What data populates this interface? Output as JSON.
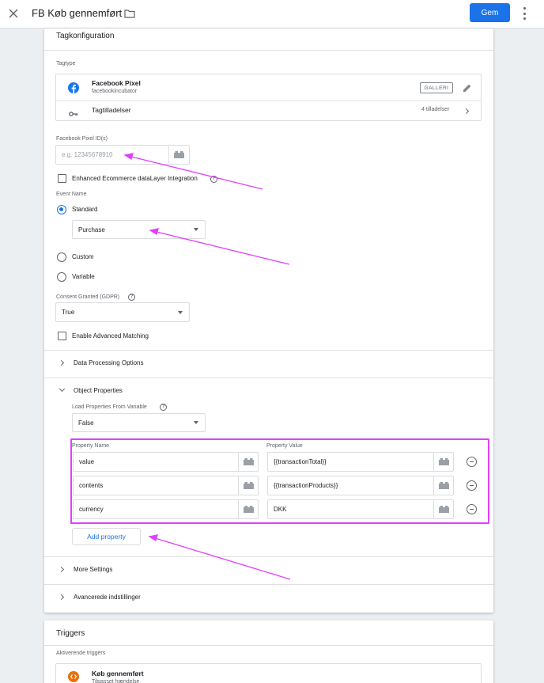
{
  "header": {
    "title": "FB Køb gennemført",
    "save_label": "Gem"
  },
  "tag_config": {
    "title": "Tagkonfiguration",
    "tag_type_label": "Tagtype",
    "tag_name": "Facebook Pixel",
    "tag_vendor": "facebookincubator",
    "gallery_label": "GALLERI",
    "permissions_label": "Tagtilladelser",
    "permissions_count": "4 tilladelser",
    "pixel_id_label": "Facebook Pixel ID(s)",
    "pixel_id_placeholder": "e.g. 12345678910",
    "enhanced_ecommerce_label": "Enhanced Ecommerce dataLayer Integration",
    "event_name_label": "Event Name",
    "event_options": {
      "standard": "Standard",
      "custom": "Custom",
      "variable": "Variable"
    },
    "standard_event_value": "Purchase",
    "consent_label": "Consent Granted (GDPR)",
    "consent_value": "True",
    "advanced_matching_label": "Enable Advanced Matching",
    "data_processing_label": "Data Processing Options",
    "object_properties_label": "Object Properties",
    "load_from_variable_label": "Load Properties From Variable",
    "load_from_variable_value": "False",
    "property_name_header": "Property Name",
    "property_value_header": "Property Value",
    "properties": [
      {
        "name": "value",
        "value": "{{transactionTotal}}"
      },
      {
        "name": "contents",
        "value": "{{transactionProducts}}"
      },
      {
        "name": "currency",
        "value": "DKK"
      }
    ],
    "add_property_label": "Add property",
    "more_settings_label": "More Settings",
    "advanced_settings_label": "Avancerede indstillinger"
  },
  "triggers": {
    "title": "Triggers",
    "firing_label": "Aktiverende triggers",
    "trigger_name": "Køb gennemført",
    "trigger_type": "Tilpasset hændelse"
  },
  "colors": {
    "accent": "#1a73e8",
    "highlight": "#e040fb",
    "trigger_icon": "#e8710a",
    "facebook": "#1877f2"
  }
}
